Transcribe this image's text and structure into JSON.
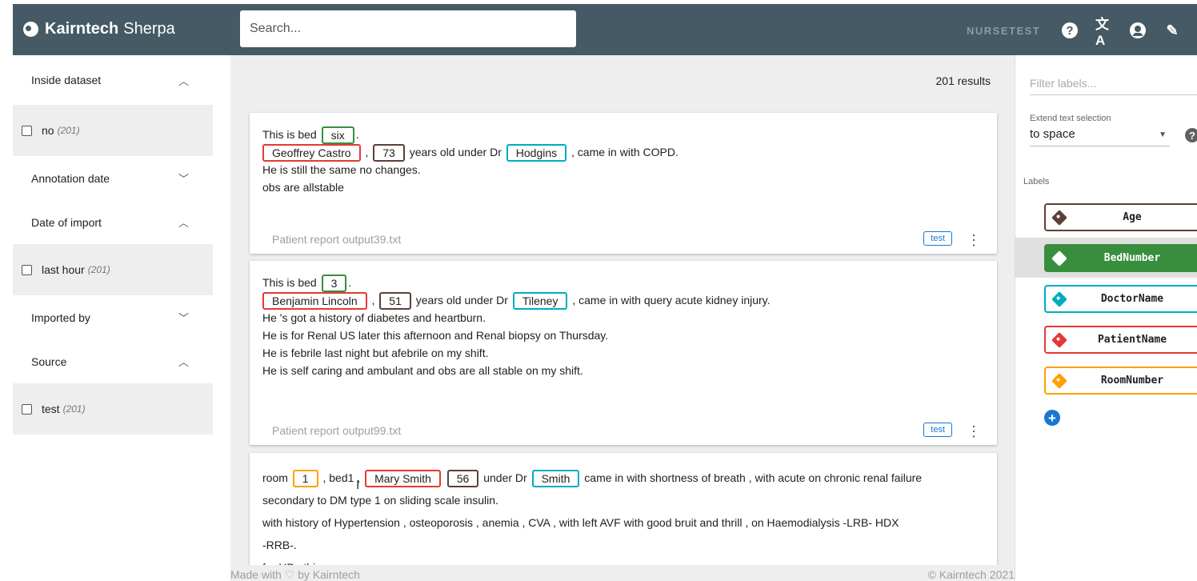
{
  "header": {
    "brand": "Kairntech",
    "product": "Sherpa",
    "search_placeholder": "Search...",
    "user": "NURSETEST",
    "icons": [
      "help-icon",
      "translate-icon",
      "account-icon",
      "pencil-icon"
    ]
  },
  "facets": [
    {
      "title": "Inside dataset",
      "expanded": true,
      "values": [
        {
          "label": "no",
          "count": "(201)"
        }
      ]
    },
    {
      "title": "Annotation date",
      "expanded": false
    },
    {
      "title": "Date of import",
      "expanded": true,
      "values": [
        {
          "label": "last hour",
          "count": "(201)"
        }
      ]
    },
    {
      "title": "Imported by",
      "expanded": false
    },
    {
      "title": "Source",
      "expanded": true,
      "values": [
        {
          "label": "test",
          "count": "(201)"
        }
      ]
    }
  ],
  "results": {
    "count": "201 results"
  },
  "cards": [
    {
      "lines": {
        "l1_pre": "This is bed",
        "l1_bed": "six",
        "l1_post": ".",
        "l2_patient": "Geoffrey Castro",
        "l2_comma": ",",
        "l2_age": "73",
        "l2_mid": "years old under Dr",
        "l2_doctor": "Hodgins",
        "l2_post": ", came in with COPD.",
        "l3": "He is still the same no changes.",
        "l4": "obs are allstable"
      },
      "filename": "Patient report output39.txt",
      "tag": "test"
    },
    {
      "lines": {
        "l1_pre": "This is bed",
        "l1_bed": "3",
        "l1_post": ".",
        "l2_patient": "Benjamin Lincoln",
        "l2_comma": ",",
        "l2_age": "51",
        "l2_mid": "years old under Dr",
        "l2_doctor": "Tileney",
        "l2_post": ", came in with query acute kidney injury.",
        "l3": "He 's got a history of diabetes and heartburn.",
        "l4": "He is for Renal US later this afternoon and Renal biopsy on Thursday.",
        "l5": "He is febrile last night but afebrile on my shift.",
        "l6": "He is self caring and ambulant and obs are all stable on my shift."
      },
      "filename": "Patient report output99.txt",
      "tag": "test"
    },
    {
      "lines": {
        "l1_pre": "room",
        "l1_room": "1",
        "l1_mid": ", bed1 ,",
        "l1_patient": "Mary Smith",
        "l1_age": "56",
        "l1_mid2": "under Dr",
        "l1_doctor": "Smith",
        "l1_post": "came in with shortness of breath , with acute on chronic renal failure",
        "l2": "secondary to DM type 1 on sliding scale insulin.",
        "l3": "with history of Hypertension , osteoporosis , anemia , CVA , with left AVF with good bruit and thrill , on Haemodialysis -LRB- HDX",
        "l4": "-RRB-.",
        "l5": "for HDx this pm"
      }
    }
  ],
  "footer": {
    "left": "Made with ♡ by Kairntech",
    "right": "©  Kairntech 2021"
  },
  "right_panel": {
    "filter_placeholder": "Filter labels...",
    "extend_label": "Extend text selection",
    "extend_value": "to space",
    "labels_title": "Labels",
    "labels": [
      {
        "name": "Age",
        "color": "#5d4037",
        "selected": false
      },
      {
        "name": "BedNumber",
        "color": "#388e3c",
        "selected": true
      },
      {
        "name": "DoctorName",
        "color": "#00acc1",
        "selected": false
      },
      {
        "name": "PatientName",
        "color": "#e53935",
        "selected": false
      },
      {
        "name": "RoomNumber",
        "color": "#ffa000",
        "selected": false
      }
    ]
  }
}
